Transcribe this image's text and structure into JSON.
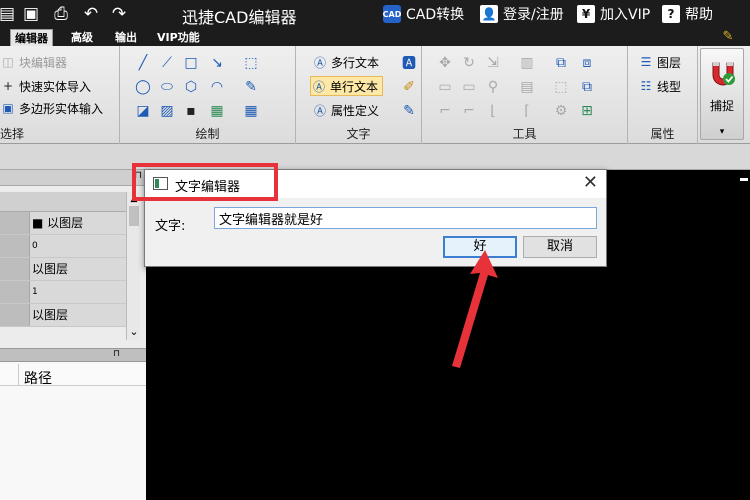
{
  "titlebar": {
    "app_title": "迅捷CAD编辑器",
    "actions": {
      "cad_convert": "CAD转换",
      "login": "登录/注册",
      "vip": "加入VIP",
      "help": "帮助"
    },
    "cad_badge": "CAD"
  },
  "menu": {
    "tabs": [
      "编辑器",
      "高级",
      "输出",
      "VIP功能"
    ]
  },
  "ribbon": {
    "select_group": {
      "label": "选择",
      "block_editor": "块编辑器",
      "quick_import": "快速实体导入",
      "polygon_input": "多边形实体输入"
    },
    "draw_group": {
      "label": "绘制"
    },
    "text_group": {
      "label": "文字",
      "mtext": "多行文本",
      "stext": "单行文本",
      "attr_def": "属性定义"
    },
    "tools_group": {
      "label": "工具"
    },
    "props_group": {
      "label": "属性",
      "layer": "图层",
      "linetype": "线型"
    },
    "snap": {
      "label": "捕捉"
    }
  },
  "left_panel": {
    "rows": [
      "■ 以图层",
      "0",
      "以图层",
      "1",
      "以图层"
    ],
    "path_header": "路径"
  },
  "dialog": {
    "title": "文字编辑器",
    "text_label": "文字:",
    "text_value": "文字编辑器就是好",
    "ok": "好",
    "cancel": "取消"
  },
  "colors": {
    "accent": "#3c7fd1",
    "annotation": "#e8323a",
    "canvas": "#000000"
  }
}
